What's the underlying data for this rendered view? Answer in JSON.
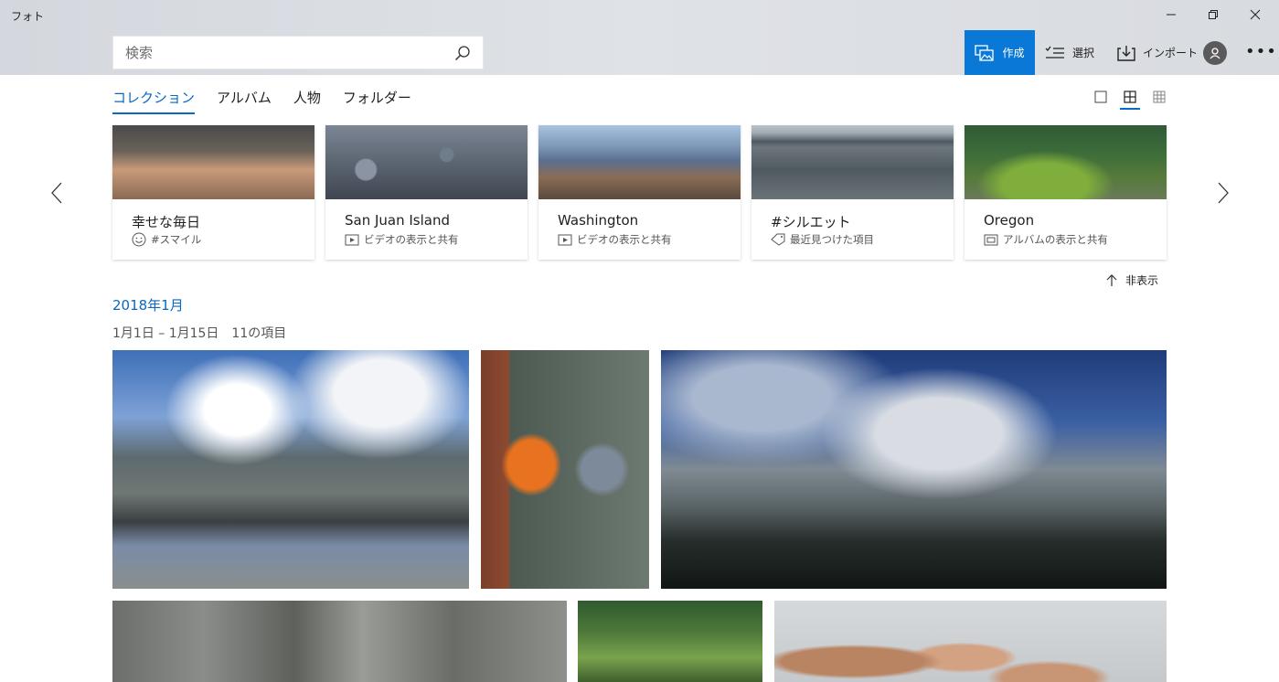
{
  "app": {
    "title": "フォト"
  },
  "search": {
    "placeholder": "検索"
  },
  "commands": {
    "create": "作成",
    "select": "選択",
    "import": "インポート"
  },
  "tabs": [
    {
      "label": "コレクション",
      "active": true
    },
    {
      "label": "アルバム"
    },
    {
      "label": "人物"
    },
    {
      "label": "フォルダー"
    }
  ],
  "cards": [
    {
      "title": "幸せな毎日",
      "subtitle": "#スマイル",
      "icon": "smile-icon"
    },
    {
      "title": "San Juan Island",
      "subtitle": "ビデオの表示と共有",
      "icon": "video-icon"
    },
    {
      "title": "Washington",
      "subtitle": "ビデオの表示と共有",
      "icon": "video-icon"
    },
    {
      "title": "#シルエット",
      "subtitle": "最近見つけた項目",
      "icon": "tag-icon"
    },
    {
      "title": "Oregon",
      "subtitle": "アルバムの表示と共有",
      "icon": "album-icon"
    }
  ],
  "hide_label": "非表示",
  "section": {
    "month": "2018年1月",
    "range": "1月1日 – 1月15日　11の項目"
  },
  "colors": {
    "accent": "#0a78d7",
    "link": "#0a67c2"
  }
}
